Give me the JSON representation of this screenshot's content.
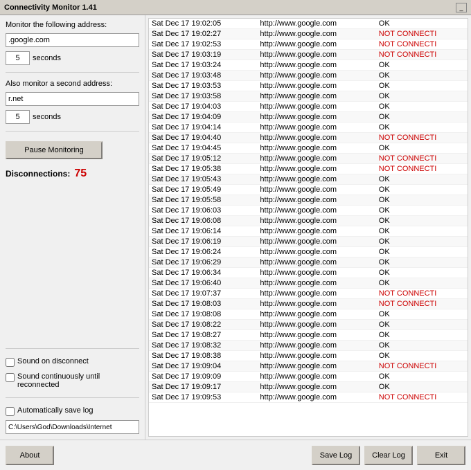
{
  "titleBar": {
    "title": "Connectivity Monitor 1.41",
    "minimizeLabel": "_"
  },
  "leftPanel": {
    "primaryAddressLabel": "Monitor the following address:",
    "primaryAddressValue": ".google.com",
    "primaryIntervalValue": "5",
    "primaryIntervalLabel": "seconds",
    "secondaryAddressLabel": "Also monitor a second address:",
    "secondaryAddressValue": "r.net",
    "secondaryIntervalValue": "5",
    "secondaryIntervalLabel": "seconds",
    "pauseButtonLabel": "Pause Monitoring",
    "disconnectionsLabel": "Disconnections:",
    "disconnectionsValue": "75",
    "soundOnDisconnectLabel": "Sound on disconnect",
    "soundContinuousLabel": "Sound continuously until reconnected",
    "autoSaveLabel": "Automatically save log",
    "savePathValue": "C:\\Users\\God\\Downloads\\Internet"
  },
  "logTable": {
    "rows": [
      {
        "datetime": "Sat Dec 17 19:02:05",
        "url": "http://www.google.com",
        "status": "OK"
      },
      {
        "datetime": "Sat Dec 17 19:02:27",
        "url": "http://www.google.com",
        "status": "NOT CONNECTI"
      },
      {
        "datetime": "Sat Dec 17 19:02:53",
        "url": "http://www.google.com",
        "status": "NOT CONNECTI"
      },
      {
        "datetime": "Sat Dec 17 19:03:19",
        "url": "http://www.google.com",
        "status": "NOT CONNECTI"
      },
      {
        "datetime": "Sat Dec 17 19:03:24",
        "url": "http://www.google.com",
        "status": "OK"
      },
      {
        "datetime": "Sat Dec 17 19:03:48",
        "url": "http://www.google.com",
        "status": "OK"
      },
      {
        "datetime": "Sat Dec 17 19:03:53",
        "url": "http://www.google.com",
        "status": "OK"
      },
      {
        "datetime": "Sat Dec 17 19:03:58",
        "url": "http://www.google.com",
        "status": "OK"
      },
      {
        "datetime": "Sat Dec 17 19:04:03",
        "url": "http://www.google.com",
        "status": "OK"
      },
      {
        "datetime": "Sat Dec 17 19:04:09",
        "url": "http://www.google.com",
        "status": "OK"
      },
      {
        "datetime": "Sat Dec 17 19:04:14",
        "url": "http://www.google.com",
        "status": "OK"
      },
      {
        "datetime": "Sat Dec 17 19:04:40",
        "url": "http://www.google.com",
        "status": "NOT CONNECTI"
      },
      {
        "datetime": "Sat Dec 17 19:04:45",
        "url": "http://www.google.com",
        "status": "OK"
      },
      {
        "datetime": "Sat Dec 17 19:05:12",
        "url": "http://www.google.com",
        "status": "NOT CONNECTI"
      },
      {
        "datetime": "Sat Dec 17 19:05:38",
        "url": "http://www.google.com",
        "status": "NOT CONNECTI"
      },
      {
        "datetime": "Sat Dec 17 19:05:43",
        "url": "http://www.google.com",
        "status": "OK"
      },
      {
        "datetime": "Sat Dec 17 19:05:49",
        "url": "http://www.google.com",
        "status": "OK"
      },
      {
        "datetime": "Sat Dec 17 19:05:58",
        "url": "http://www.google.com",
        "status": "OK"
      },
      {
        "datetime": "Sat Dec 17 19:06:03",
        "url": "http://www.google.com",
        "status": "OK"
      },
      {
        "datetime": "Sat Dec 17 19:06:08",
        "url": "http://www.google.com",
        "status": "OK"
      },
      {
        "datetime": "Sat Dec 17 19:06:14",
        "url": "http://www.google.com",
        "status": "OK"
      },
      {
        "datetime": "Sat Dec 17 19:06:19",
        "url": "http://www.google.com",
        "status": "OK"
      },
      {
        "datetime": "Sat Dec 17 19:06:24",
        "url": "http://www.google.com",
        "status": "OK"
      },
      {
        "datetime": "Sat Dec 17 19:06:29",
        "url": "http://www.google.com",
        "status": "OK"
      },
      {
        "datetime": "Sat Dec 17 19:06:34",
        "url": "http://www.google.com",
        "status": "OK"
      },
      {
        "datetime": "Sat Dec 17 19:06:40",
        "url": "http://www.google.com",
        "status": "OK"
      },
      {
        "datetime": "Sat Dec 17 19:07:37",
        "url": "http://www.google.com",
        "status": "NOT CONNECTI"
      },
      {
        "datetime": "Sat Dec 17 19:08:03",
        "url": "http://www.google.com",
        "status": "NOT CONNECTI"
      },
      {
        "datetime": "Sat Dec 17 19:08:08",
        "url": "http://www.google.com",
        "status": "OK"
      },
      {
        "datetime": "Sat Dec 17 19:08:22",
        "url": "http://www.google.com",
        "status": "OK"
      },
      {
        "datetime": "Sat Dec 17 19:08:27",
        "url": "http://www.google.com",
        "status": "OK"
      },
      {
        "datetime": "Sat Dec 17 19:08:32",
        "url": "http://www.google.com",
        "status": "OK"
      },
      {
        "datetime": "Sat Dec 17 19:08:38",
        "url": "http://www.google.com",
        "status": "OK"
      },
      {
        "datetime": "Sat Dec 17 19:09:04",
        "url": "http://www.google.com",
        "status": "NOT CONNECTI"
      },
      {
        "datetime": "Sat Dec 17 19:09:09",
        "url": "http://www.google.com",
        "status": "OK"
      },
      {
        "datetime": "Sat Dec 17 19:09:17",
        "url": "http://www.google.com",
        "status": "OK"
      },
      {
        "datetime": "Sat Dec 17 19:09:53",
        "url": "http://www.google.com",
        "status": "NOT CONNECTI"
      }
    ]
  },
  "bottomBar": {
    "aboutLabel": "About",
    "saveLogLabel": "Save Log",
    "clearLogLabel": "Clear Log",
    "exitLabel": "Exit"
  }
}
